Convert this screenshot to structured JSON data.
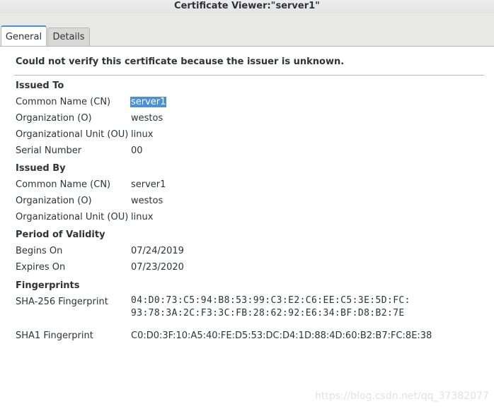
{
  "window": {
    "title": "Certificate Viewer:\"server1\""
  },
  "tabs": [
    {
      "label": "General"
    },
    {
      "label": "Details"
    }
  ],
  "general": {
    "warning": "Could not verify this certificate because the issuer is unknown.",
    "issued_to": {
      "heading": "Issued To",
      "rows": [
        {
          "label": "Common Name (CN)",
          "value": "server1"
        },
        {
          "label": "Organization (O)",
          "value": "westos"
        },
        {
          "label": "Organizational Unit (OU)",
          "value": "linux"
        },
        {
          "label": "Serial Number",
          "value": "00"
        }
      ]
    },
    "issued_by": {
      "heading": "Issued By",
      "rows": [
        {
          "label": "Common Name (CN)",
          "value": "server1"
        },
        {
          "label": "Organization (O)",
          "value": "westos"
        },
        {
          "label": "Organizational Unit (OU)",
          "value": "linux"
        }
      ]
    },
    "validity": {
      "heading": "Period of Validity",
      "rows": [
        {
          "label": "Begins On",
          "value": "07/24/2019"
        },
        {
          "label": "Expires On",
          "value": "07/23/2020"
        }
      ]
    },
    "fingerprints": {
      "heading": "Fingerprints",
      "sha256_label": "SHA-256 Fingerprint",
      "sha256_line1": "04:D0:73:C5:94:B8:53:99:C3:E2:C6:EE:C5:3E:5D:FC:",
      "sha256_line2": "93:78:3A:2C:F3:3C:FB:28:62:92:E6:34:BF:D8:B2:7E",
      "sha1_label": "SHA1 Fingerprint",
      "sha1_value": "C0:D0:3F:10:A5:40:FE:D5:53:DC:D4:1D:88:4D:60:B2:B7:FC:8E:38"
    }
  },
  "watermark": "https://blog.csdn.net/qq_37382077",
  "colors": {
    "selection": "#4a90d9",
    "tab_accent": "#4a90d9"
  }
}
